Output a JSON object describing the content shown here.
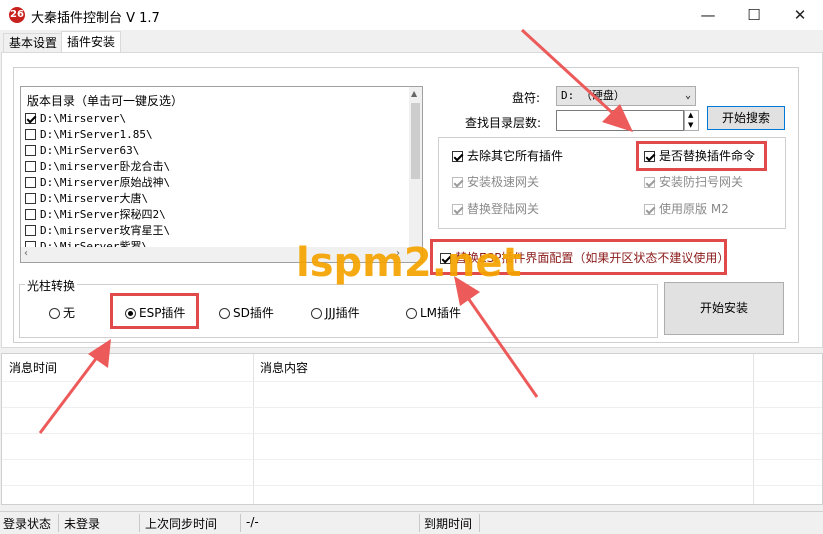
{
  "window": {
    "title": "大秦插件控制台 V 1.7",
    "icon_text": "26",
    "controls": [
      "minimize-icon",
      "maximize-icon",
      "close-icon"
    ]
  },
  "tabs": [
    {
      "label": "基本设置",
      "active": false
    },
    {
      "label": "插件安装",
      "active": true
    }
  ],
  "directory": {
    "header": "版本目录（单击可一键反选）",
    "items": [
      {
        "path": "D:\\Mirserver\\",
        "checked": true
      },
      {
        "path": "D:\\MirServer1.85\\",
        "checked": false
      },
      {
        "path": "D:\\MirServer63\\",
        "checked": false
      },
      {
        "path": "D:\\mirserver卧龙合击\\",
        "checked": false
      },
      {
        "path": "D:\\Mirserver原始战神\\",
        "checked": false
      },
      {
        "path": "D:\\Mirserver大唐\\",
        "checked": false
      },
      {
        "path": "D:\\MirServer探秘四2\\",
        "checked": false
      },
      {
        "path": "D:\\mirserver玫宵星王\\",
        "checked": false
      },
      {
        "path": "D:\\MirServer紫罗\\",
        "checked": false
      }
    ]
  },
  "search": {
    "drive_label": "盘符:",
    "drive_value": "D: （硬盘）",
    "depth_label": "查找目录层数:",
    "depth_value": "",
    "search_button": "开始搜索"
  },
  "options": [
    {
      "label": "去除其它所有插件",
      "checked": true,
      "enabled": true
    },
    {
      "label": "是否替换插件命令",
      "checked": true,
      "enabled": true
    },
    {
      "label": "安装极速网关",
      "checked": true,
      "enabled": false
    },
    {
      "label": "安装防扫号网关",
      "checked": true,
      "enabled": false
    },
    {
      "label": "替换登陆网关",
      "checked": true,
      "enabled": false
    },
    {
      "label": "使用原版 M2",
      "checked": true,
      "enabled": false
    }
  ],
  "esp_config": {
    "label": "替换ESP插件界面配置（如果开区状态不建议使用）",
    "checked": true
  },
  "light_pillar": {
    "title": "光柱转换",
    "options": [
      {
        "label": "无",
        "selected": false
      },
      {
        "label": "ESP插件",
        "selected": true
      },
      {
        "label": "SD插件",
        "selected": false
      },
      {
        "label": "JJJ插件",
        "selected": false
      },
      {
        "label": "LM插件",
        "selected": false
      }
    ]
  },
  "install_button": "开始安装",
  "log": {
    "columns": [
      "消息时间",
      "消息内容"
    ]
  },
  "status_bar": {
    "login_label": "登录状态",
    "login_value": "未登录",
    "sync_label": "上次同步时间",
    "sync_value": "-/-",
    "expire_label": "到期时间",
    "expire_value": ""
  },
  "watermark": "lspm2.net",
  "colors": {
    "highlight_box": "#e04a4a",
    "arrow": "#ec5a5a",
    "watermark": "#f5a300"
  }
}
